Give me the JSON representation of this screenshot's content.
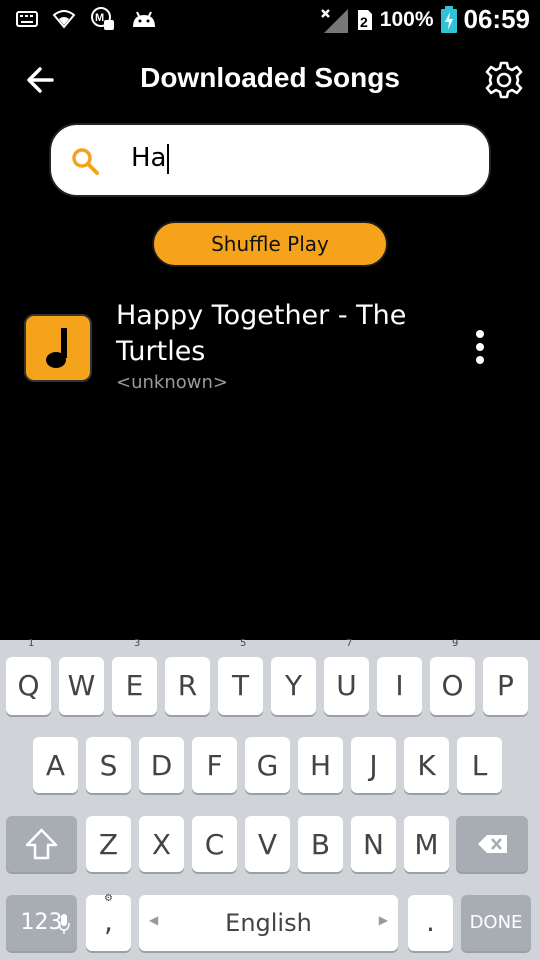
{
  "status_bar": {
    "battery": "100%",
    "time": "06:59",
    "icons": [
      "keyboard-icon",
      "wifi-icon",
      "notification-icon",
      "android-icon",
      "no-signal-icon",
      "sim-icon",
      "battery-charging-icon"
    ]
  },
  "app_bar": {
    "title": "Downloaded Songs",
    "back_icon": "arrow-left-icon",
    "settings_icon": "gear-icon"
  },
  "search": {
    "value": "Ha",
    "icon": "search-icon"
  },
  "shuffle": {
    "label": "Shuffle Play"
  },
  "songs": [
    {
      "title": "Happy Together - The Turtles",
      "artist": "<unknown>",
      "icon": "music-note-icon"
    }
  ],
  "keyboard": {
    "row1": [
      "Q",
      "W",
      "E",
      "R",
      "T",
      "Y",
      "U",
      "I",
      "O",
      "P"
    ],
    "row1_hints": [
      "1",
      "3",
      "5",
      "7",
      "9"
    ],
    "row2": [
      "A",
      "S",
      "D",
      "F",
      "G",
      "H",
      "J",
      "K",
      "L"
    ],
    "row3": [
      "Z",
      "X",
      "C",
      "V",
      "B",
      "N",
      "M"
    ],
    "num_key": "123",
    "comma_key": ",",
    "space_label": "English",
    "period_key": ".",
    "done_key": "DONE"
  },
  "colors": {
    "accent": "#f6a31c",
    "background": "#000000",
    "keyboard_bg": "#d0d4d9"
  }
}
